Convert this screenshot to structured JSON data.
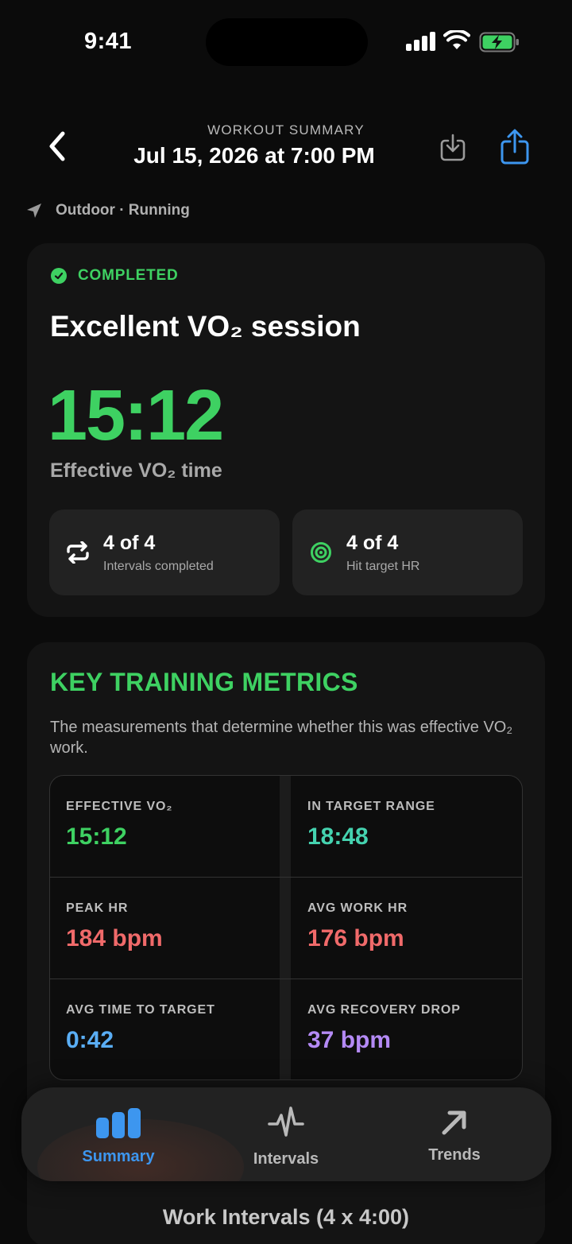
{
  "status_bar": {
    "time": "9:41"
  },
  "header": {
    "kicker": "WORKOUT SUMMARY",
    "date": "Jul 15, 2026 at 7:00 PM"
  },
  "location": {
    "text": "Outdoor · Running"
  },
  "summary": {
    "status": "COMPLETED",
    "title": "Excellent VO₂ session",
    "big_value": "15:12",
    "big_label": "Effective VO₂ time",
    "stats": [
      {
        "value": "4 of 4",
        "label": "Intervals completed",
        "icon": "repeat-icon"
      },
      {
        "value": "4 of 4",
        "label": "Hit target HR",
        "icon": "target-icon"
      }
    ]
  },
  "metrics": {
    "title": "KEY TRAINING METRICS",
    "subtitle": "The measurements that determine whether this was effective VO₂ work.",
    "cells": [
      {
        "label": "EFFECTIVE VO₂",
        "value": "15:12",
        "color": "#3ed162"
      },
      {
        "label": "IN TARGET RANGE",
        "value": "18:48",
        "color": "#45d3b0"
      },
      {
        "label": "PEAK HR",
        "value": "184 bpm",
        "color": "#f06a6a"
      },
      {
        "label": "AVG WORK HR",
        "value": "176 bpm",
        "color": "#f06a6a"
      },
      {
        "label": "AVG TIME TO TARGET",
        "value": "0:42",
        "color": "#5aaef5"
      },
      {
        "label": "AVG RECOVERY DROP",
        "value": "37 bpm",
        "color": "#b48af5"
      }
    ]
  },
  "tabs": [
    {
      "label": "Summary",
      "icon": "bar-chart-icon",
      "active": true
    },
    {
      "label": "Intervals",
      "icon": "heartbeat-icon",
      "active": false
    },
    {
      "label": "Trends",
      "icon": "arrow-up-right-icon",
      "active": false
    }
  ],
  "next_section": {
    "title": "Work Intervals (4 x 4:00)"
  },
  "colors": {
    "accent_green": "#3ed162",
    "tab_active": "#3d96ef",
    "tab_inactive": "#b9b9b9"
  }
}
